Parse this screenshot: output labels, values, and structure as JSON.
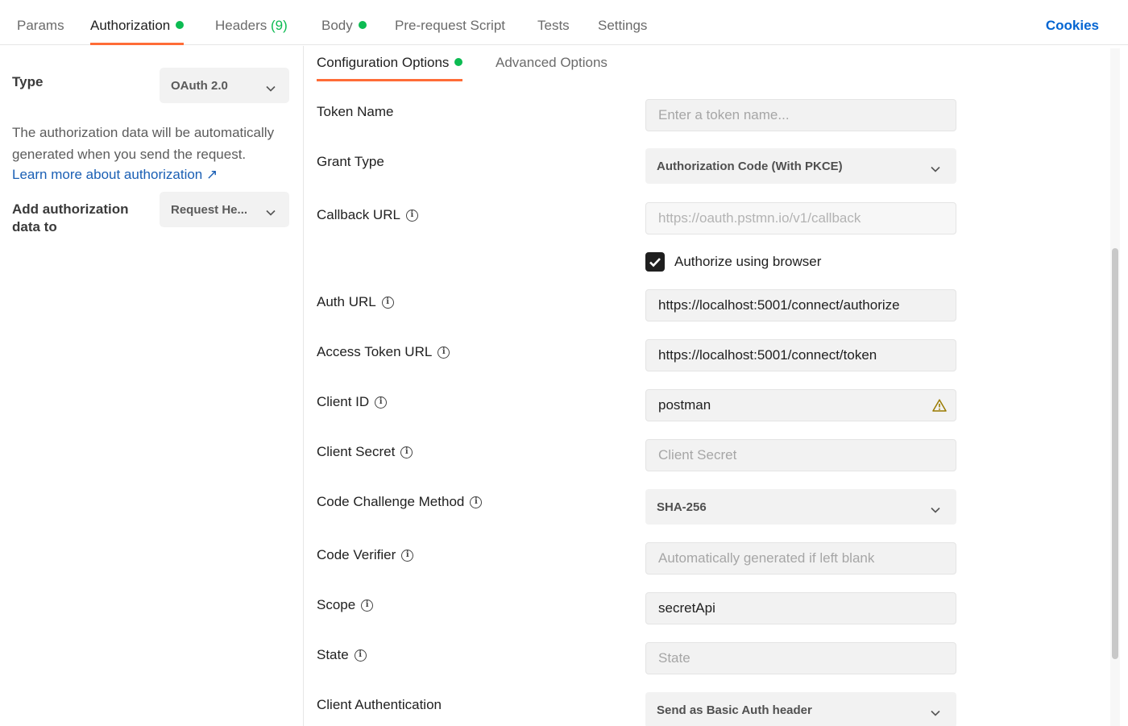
{
  "top_tabs": {
    "params": "Params",
    "authorization": "Authorization",
    "headers": "Headers",
    "headers_count": "(9)",
    "body": "Body",
    "pre_request": "Pre-request Script",
    "tests": "Tests",
    "settings": "Settings",
    "cookies": "Cookies"
  },
  "colors": {
    "accent": "#ff6c37",
    "status_green": "#0cbb52",
    "link_blue": "#0265d2",
    "warning": "#d4a017"
  },
  "left_panel": {
    "type_label": "Type",
    "type_value": "OAuth 2.0",
    "description": "The authorization data will be automatically generated when you send the request.",
    "learn_more": "Learn more about authorization ↗",
    "add_to_label": "Add authorization data to",
    "add_to_value": "Request He..."
  },
  "sub_tabs": {
    "config": "Configuration Options",
    "advanced": "Advanced Options"
  },
  "fields": {
    "token_name": {
      "label": "Token Name",
      "placeholder": "Enter a token name..."
    },
    "grant_type": {
      "label": "Grant Type",
      "value": "Authorization Code (With PKCE)"
    },
    "callback_url": {
      "label": "Callback URL",
      "placeholder": "https://oauth.pstmn.io/v1/callback"
    },
    "authorize_browser": {
      "label": "Authorize using browser",
      "checked": true
    },
    "auth_url": {
      "label": "Auth URL",
      "value": "https://localhost:5001/connect/authorize"
    },
    "access_token_url": {
      "label": "Access Token URL",
      "value": "https://localhost:5001/connect/token"
    },
    "client_id": {
      "label": "Client ID",
      "value": "postman",
      "icon": "warning-icon"
    },
    "client_secret": {
      "label": "Client Secret",
      "placeholder": "Client Secret"
    },
    "code_challenge_method": {
      "label": "Code Challenge Method",
      "value": "SHA-256"
    },
    "code_verifier": {
      "label": "Code Verifier",
      "placeholder": "Automatically generated if left blank"
    },
    "scope": {
      "label": "Scope",
      "value": "secretApi"
    },
    "state": {
      "label": "State",
      "placeholder": "State"
    },
    "client_authentication": {
      "label": "Client Authentication",
      "value": "Send as Basic Auth header"
    }
  }
}
